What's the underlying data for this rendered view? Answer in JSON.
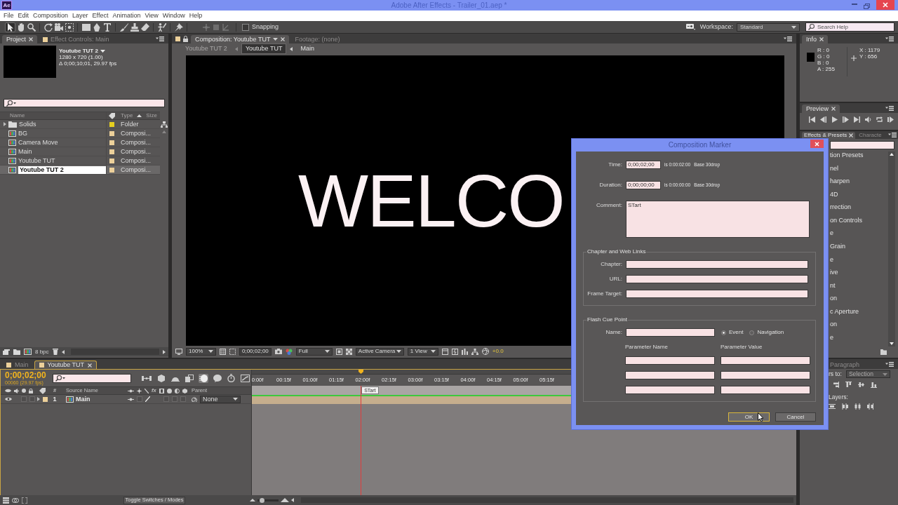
{
  "window": {
    "app_icon": "Ae",
    "title": "Adobe After Effects - Trailer_01.aep *"
  },
  "menu": [
    "File",
    "Edit",
    "Composition",
    "Layer",
    "Effect",
    "Animation",
    "View",
    "Window",
    "Help"
  ],
  "toolbar": {
    "tools": [
      {
        "kind": "selection",
        "selected": true
      },
      {
        "kind": "hand",
        "selected": false
      },
      {
        "kind": "zoom",
        "selected": false
      },
      {
        "kind": "rotate",
        "selected": false
      },
      {
        "kind": "camera",
        "selected": false
      },
      {
        "kind": "panbehind",
        "selected": false
      },
      {
        "kind": "rectangle",
        "selected": false
      },
      {
        "kind": "pen",
        "selected": false
      },
      {
        "kind": "type",
        "selected": false
      },
      {
        "kind": "brush",
        "selected": false
      },
      {
        "kind": "clone",
        "selected": false
      },
      {
        "kind": "eraser",
        "selected": false
      },
      {
        "kind": "roto",
        "selected": false
      },
      {
        "kind": "puppet",
        "selected": false
      }
    ],
    "snapping": {
      "label": "Snapping",
      "checked": false
    },
    "workspace_label": "Workspace:",
    "workspace": "Standard",
    "search": {
      "placeholder": "Search Help"
    }
  },
  "project_panel": {
    "tabs": [
      {
        "label": "Project",
        "selected": true,
        "closable": true
      },
      {
        "label": "Effect Controls: Main",
        "selected": false,
        "closable": false
      }
    ],
    "selection": {
      "name": "Youtube TUT 2",
      "size": "1280 x 720 (1.00)",
      "duration": "Δ 0;00;10;01, 29.97 fps"
    },
    "columns": {
      "name": "Name",
      "type": "Type",
      "size": "Size"
    },
    "items": [
      {
        "kind": "folder",
        "name": "Solids",
        "type": "Folder",
        "color": "#e6cf1f",
        "selected": false
      },
      {
        "kind": "composition",
        "name": "BG",
        "type": "Composi...",
        "color": "#ecd09a",
        "selected": false
      },
      {
        "kind": "composition",
        "name": "Camera Move",
        "type": "Composi...",
        "color": "#ecd09a",
        "selected": false
      },
      {
        "kind": "composition",
        "name": "Main",
        "type": "Composi...",
        "color": "#ecd09a",
        "selected": false
      },
      {
        "kind": "composition",
        "name": "Youtube TUT",
        "type": "Composi...",
        "color": "#ecd09a",
        "selected": false
      },
      {
        "kind": "composition",
        "name": "Youtube TUT 2",
        "type": "Composi...",
        "color": "#ecd09a",
        "selected": true
      }
    ],
    "bit_depth": "8 bpc"
  },
  "composition_panel": {
    "tabs": [
      {
        "label": "Composition: Youtube TUT",
        "selected": true,
        "closable": true
      },
      {
        "label": "Footage: (none)",
        "selected": false,
        "closable": false
      }
    ],
    "breadcrumbs": [
      {
        "label": "Youtube TUT 2",
        "selected": false,
        "disabled": true
      },
      {
        "label": "Youtube TUT",
        "selected": true,
        "disabled": false
      },
      {
        "label": "Main",
        "selected": false,
        "disabled": false
      }
    ],
    "viewer_text": "WELCO",
    "magnification": "100%",
    "current_time": "0;00;02;00",
    "resolution": "Full",
    "view": "Active Camera",
    "layout": "1 View",
    "exposure": "+0.0"
  },
  "timeline": {
    "tabs": [
      {
        "label": "Main",
        "selected": false,
        "closable": false
      },
      {
        "label": "Youtube TUT",
        "selected": true,
        "closable": true
      }
    ],
    "current_time": "0;00;02;00",
    "frame_info": "00060 (29.97 fps)",
    "tools": [
      {
        "kind": "flowchart",
        "on": false
      },
      {
        "kind": "draft3d",
        "on": false
      },
      {
        "kind": "shy",
        "on": false
      },
      {
        "kind": "frameblend",
        "on": false
      },
      {
        "kind": "motionblur",
        "on": true
      },
      {
        "kind": "brainstorm",
        "on": false
      },
      {
        "kind": "autokey",
        "on": false
      },
      {
        "kind": "graph",
        "on": false
      }
    ],
    "columns": {
      "number": "#",
      "source_name": "Source Name",
      "effects": "fx",
      "parent": "Parent"
    },
    "layers": [
      {
        "number": "1",
        "name": "Main",
        "color": "#ecd09a",
        "visible": true,
        "parent": "None"
      }
    ],
    "ruler": [
      "0:00f",
      "00:15f",
      "01:00f",
      "01:15f",
      "02:00f",
      "02:15f",
      "03:00f",
      "03:15f",
      "04:00f",
      "04:15f",
      "05:00f",
      "05:15f"
    ],
    "playhead": {
      "level": 0.2
    },
    "marker": "STart",
    "zoom": {
      "level": 0.15
    },
    "toggle_label": "Toggle Switches / Modes"
  },
  "info_panel": {
    "tabs": [
      {
        "label": "Info",
        "selected": true,
        "closable": true
      }
    ],
    "values": [
      "R : 0",
      "G : 0",
      "B : 0",
      "A : 255"
    ],
    "coordinates": [
      "X : 1179",
      "Y : 656"
    ]
  },
  "preview_panel": {
    "tabs": [
      {
        "label": "Preview",
        "selected": true,
        "closable": true
      }
    ]
  },
  "effects_panel": {
    "tabs": [
      {
        "label": "Effects & Presets",
        "selected": true,
        "closable": true
      },
      {
        "label": "Characte",
        "selected": false,
        "closable": false
      }
    ],
    "items": [
      "tion Presets",
      "nel",
      "harpen",
      "4D",
      "rrection",
      "on Controls",
      "e",
      "Grain",
      "e",
      "ive",
      "nt",
      "on",
      "c Aperture",
      "on",
      "e"
    ]
  },
  "align_panel": {
    "tabs": [
      {
        "label": "Paragraph",
        "selected": false,
        "closable": false
      }
    ],
    "align_label": "rs to:",
    "target": {
      "label": "Selection",
      "disabled": true
    },
    "distribute_label": "Layers:"
  },
  "dialog": {
    "title": "Composition Marker",
    "time": {
      "label": "Time:",
      "value": "0;00;02;00",
      "timecode": "is 0:00:02:00",
      "base": "Base 30drop"
    },
    "duration": {
      "label": "Duration:",
      "value": "0;00;00;00",
      "timecode": "is 0:00:00:00",
      "base": "Base 30drop"
    },
    "comment": {
      "label": "Comment:",
      "value": "STart"
    },
    "chapter_group": {
      "title": "Chapter and Web Links",
      "fields": [
        {
          "label": "Chapter:"
        },
        {
          "label": "URL:"
        },
        {
          "label": "Frame Target:"
        }
      ]
    },
    "cue_group": {
      "title": "Flash Cue Point",
      "name_label": "Name:",
      "types": [
        {
          "label": "Event",
          "selected": true
        },
        {
          "label": "Navigation",
          "selected": false
        }
      ],
      "parameter_columns": [
        "Parameter Name",
        "Parameter Value"
      ]
    },
    "buttons": [
      {
        "label": "OK",
        "default": true
      },
      {
        "label": "Cancel",
        "default": false
      }
    ]
  }
}
